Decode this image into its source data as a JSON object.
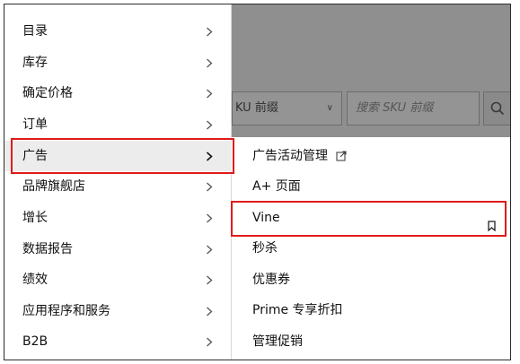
{
  "background": {
    "select_text": "KU 前缀",
    "search_placeholder": "搜索 SKU 前缀",
    "search_icon": "search-icon"
  },
  "menu_left": {
    "items": [
      {
        "label": "目录"
      },
      {
        "label": "库存"
      },
      {
        "label": "确定价格"
      },
      {
        "label": "订单"
      },
      {
        "label": "广告",
        "active": true
      },
      {
        "label": "品牌旗舰店"
      },
      {
        "label": "增长"
      },
      {
        "label": "数据报告"
      },
      {
        "label": "绩效"
      },
      {
        "label": "应用程序和服务"
      },
      {
        "label": "B2B"
      }
    ],
    "arrow_icon": "chevron-right-icon"
  },
  "menu_right": {
    "items": [
      {
        "label": "广告活动管理",
        "icon": "external-link-icon"
      },
      {
        "label": "A+ 页面"
      },
      {
        "label": "Vine",
        "icon": "bookmark-icon"
      },
      {
        "label": "秒杀"
      },
      {
        "label": "优惠券"
      },
      {
        "label": "Prime 专享折扣"
      },
      {
        "label": "管理促销"
      }
    ]
  },
  "colors": {
    "highlight": "#e01b1b",
    "overlay": "#8f8f8f",
    "active_item": "#ececec"
  }
}
